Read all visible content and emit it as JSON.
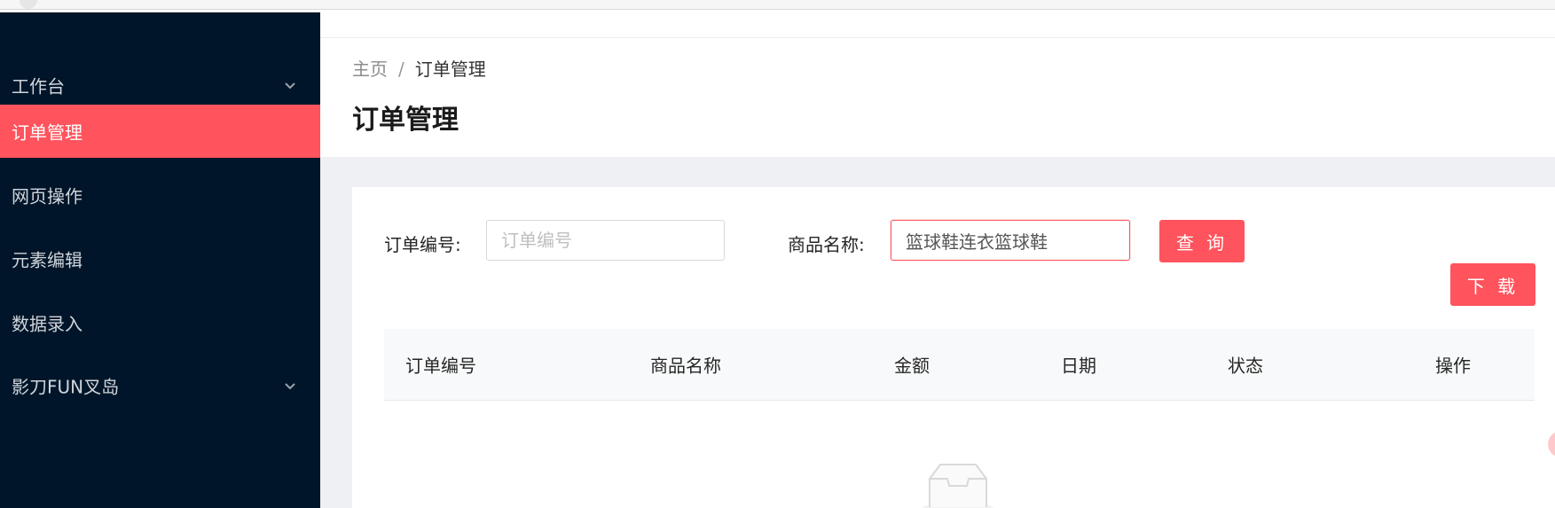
{
  "sidebar": {
    "items": [
      {
        "label": "工作台",
        "has_children": true,
        "active": false,
        "chevron_icon": "chevron-down-icon"
      },
      {
        "label": "订单管理",
        "has_children": false,
        "active": true
      },
      {
        "label": "网页操作",
        "has_children": false,
        "active": false
      },
      {
        "label": "元素编辑",
        "has_children": false,
        "active": false
      },
      {
        "label": "数据录入",
        "has_children": false,
        "active": false
      },
      {
        "label": "影刀FUN叉岛",
        "has_children": true,
        "active": false,
        "chevron_icon": "chevron-down-icon"
      }
    ]
  },
  "breadcrumb": {
    "home": "主页",
    "separator": "/",
    "current": "订单管理"
  },
  "page": {
    "title": "订单管理"
  },
  "filters": {
    "order_no_label": "订单编号:",
    "order_no_placeholder": "订单编号",
    "order_no_value": "",
    "product_name_label": "商品名称:",
    "product_name_value": "篮球鞋连衣篮球鞋",
    "query_button": "查 询",
    "download_button": "下 载"
  },
  "table": {
    "columns": [
      "订单编号",
      "商品名称",
      "金额",
      "日期",
      "状态",
      "操作"
    ],
    "rows": [],
    "empty_icon": "empty-inbox-icon"
  },
  "colors": {
    "sidebar_bg": "#001529",
    "accent": "#ff535d",
    "content_bg": "#eef0f3"
  }
}
